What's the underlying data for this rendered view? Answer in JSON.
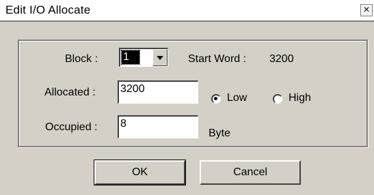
{
  "window": {
    "title": "Edit I/O Allocate",
    "close_symbol": "×"
  },
  "block": {
    "label": "Block :",
    "value": "1"
  },
  "start_word": {
    "label": "Start Word :",
    "value": "3200"
  },
  "allocated": {
    "label": "Allocated :",
    "value": "3200"
  },
  "byte_order": {
    "options": [
      {
        "label": "Low",
        "checked": true
      },
      {
        "label": "High",
        "checked": false
      }
    ]
  },
  "occupied": {
    "label": "Occupied :",
    "value": "8",
    "unit": "Byte"
  },
  "buttons": {
    "ok": "OK",
    "cancel": "Cancel"
  },
  "colors": {
    "face": "#d4d0c8",
    "shadow": "#808080",
    "dark": "#404040",
    "highlight": "#ffffff"
  }
}
